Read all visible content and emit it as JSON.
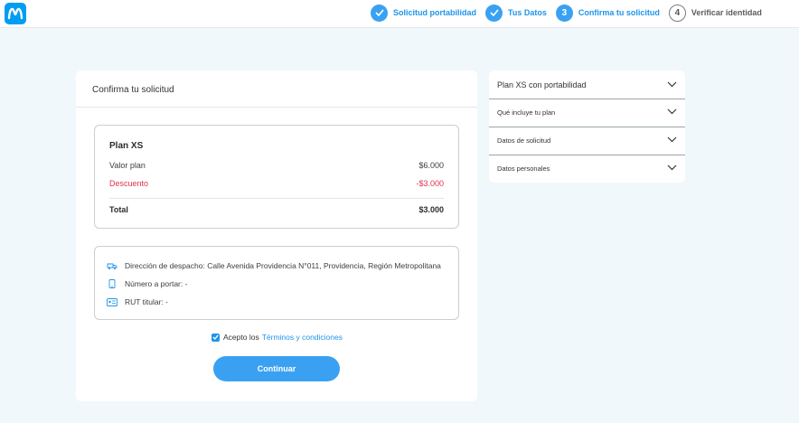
{
  "header": {
    "logo_icon": "movistar-m-logo",
    "steps": [
      {
        "number": "1",
        "label": "Solicitud portabilidad",
        "status": "done"
      },
      {
        "number": "2",
        "label": "Tus Datos",
        "status": "done"
      },
      {
        "number": "3",
        "label": "Confirma tu solicitud",
        "status": "current"
      },
      {
        "number": "4",
        "label": "Verificar identidad",
        "status": "pending"
      }
    ]
  },
  "main": {
    "title": "Confirma tu solicitud",
    "plan": {
      "name": "Plan XS",
      "valor_label": "Valor plan",
      "valor_value": "$6.000",
      "descuento_label": "Descuento",
      "descuento_value": "-$3.000",
      "total_label": "Total",
      "total_value": "$3.000"
    },
    "info": {
      "direccion": "Dirección de despacho: Calle Avenida Providencia N°011, Providencia, Región Metropolitana",
      "numero": "Número a portar: -",
      "rut": "RUT titular: -"
    },
    "terms": {
      "prefix": "Acepto los",
      "link": "Términos y condiciones",
      "checked": true
    },
    "continue_label": "Continuar"
  },
  "sidebar": {
    "items": [
      {
        "label": "Plan XS con portabilidad"
      },
      {
        "label": "Qué incluye tu plan"
      },
      {
        "label": "Datos de solicitud"
      },
      {
        "label": "Datos personales"
      }
    ]
  },
  "colors": {
    "accent": "#3aa1f2",
    "link": "#1f94e8",
    "discount": "#e0324b",
    "background": "#f1f8fc"
  }
}
